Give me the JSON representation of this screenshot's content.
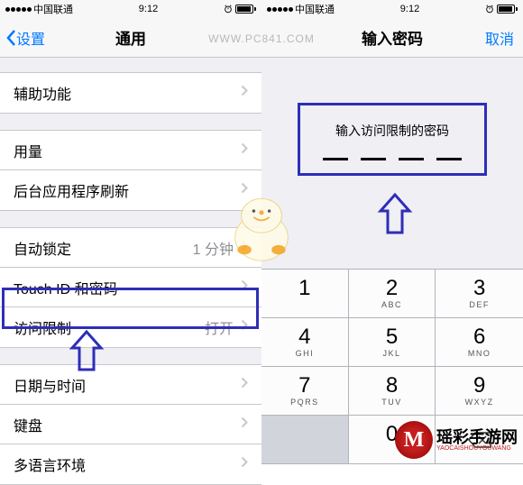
{
  "watermark_url": "WWW.PC841.COM",
  "left": {
    "status": {
      "carrier": "中国联通",
      "time": "9:12"
    },
    "nav": {
      "back": "设置",
      "title": "通用"
    },
    "groups": [
      {
        "rows": [
          {
            "label": "辅助功能"
          }
        ]
      },
      {
        "rows": [
          {
            "label": "用量"
          },
          {
            "label": "后台应用程序刷新"
          }
        ]
      },
      {
        "rows": [
          {
            "label": "自动锁定",
            "detail": "1 分钟"
          },
          {
            "label": "Touch ID 和密码"
          },
          {
            "label": "访问限制",
            "detail": "打开",
            "highlight": true
          }
        ]
      },
      {
        "rows": [
          {
            "label": "日期与时间"
          },
          {
            "label": "键盘"
          },
          {
            "label": "多语言环境"
          }
        ]
      }
    ]
  },
  "right": {
    "status": {
      "carrier": "中国联通",
      "time": "9:12"
    },
    "nav": {
      "title": "输入密码",
      "cancel": "取消"
    },
    "passcode_label": "输入访问限制的密码",
    "keypad": [
      {
        "n": "1",
        "l": ""
      },
      {
        "n": "2",
        "l": "ABC"
      },
      {
        "n": "3",
        "l": "DEF"
      },
      {
        "n": "4",
        "l": "GHI"
      },
      {
        "n": "5",
        "l": "JKL"
      },
      {
        "n": "6",
        "l": "MNO"
      },
      {
        "n": "7",
        "l": "PQRS"
      },
      {
        "n": "8",
        "l": "TUV"
      },
      {
        "n": "9",
        "l": "WXYZ"
      },
      {
        "blank": true
      },
      {
        "n": "0",
        "l": ""
      },
      {
        "icon": "backspace"
      }
    ]
  },
  "logo": {
    "cn": "瑶彩手游网",
    "py": "YAOCAISHOUYOUWANG"
  }
}
